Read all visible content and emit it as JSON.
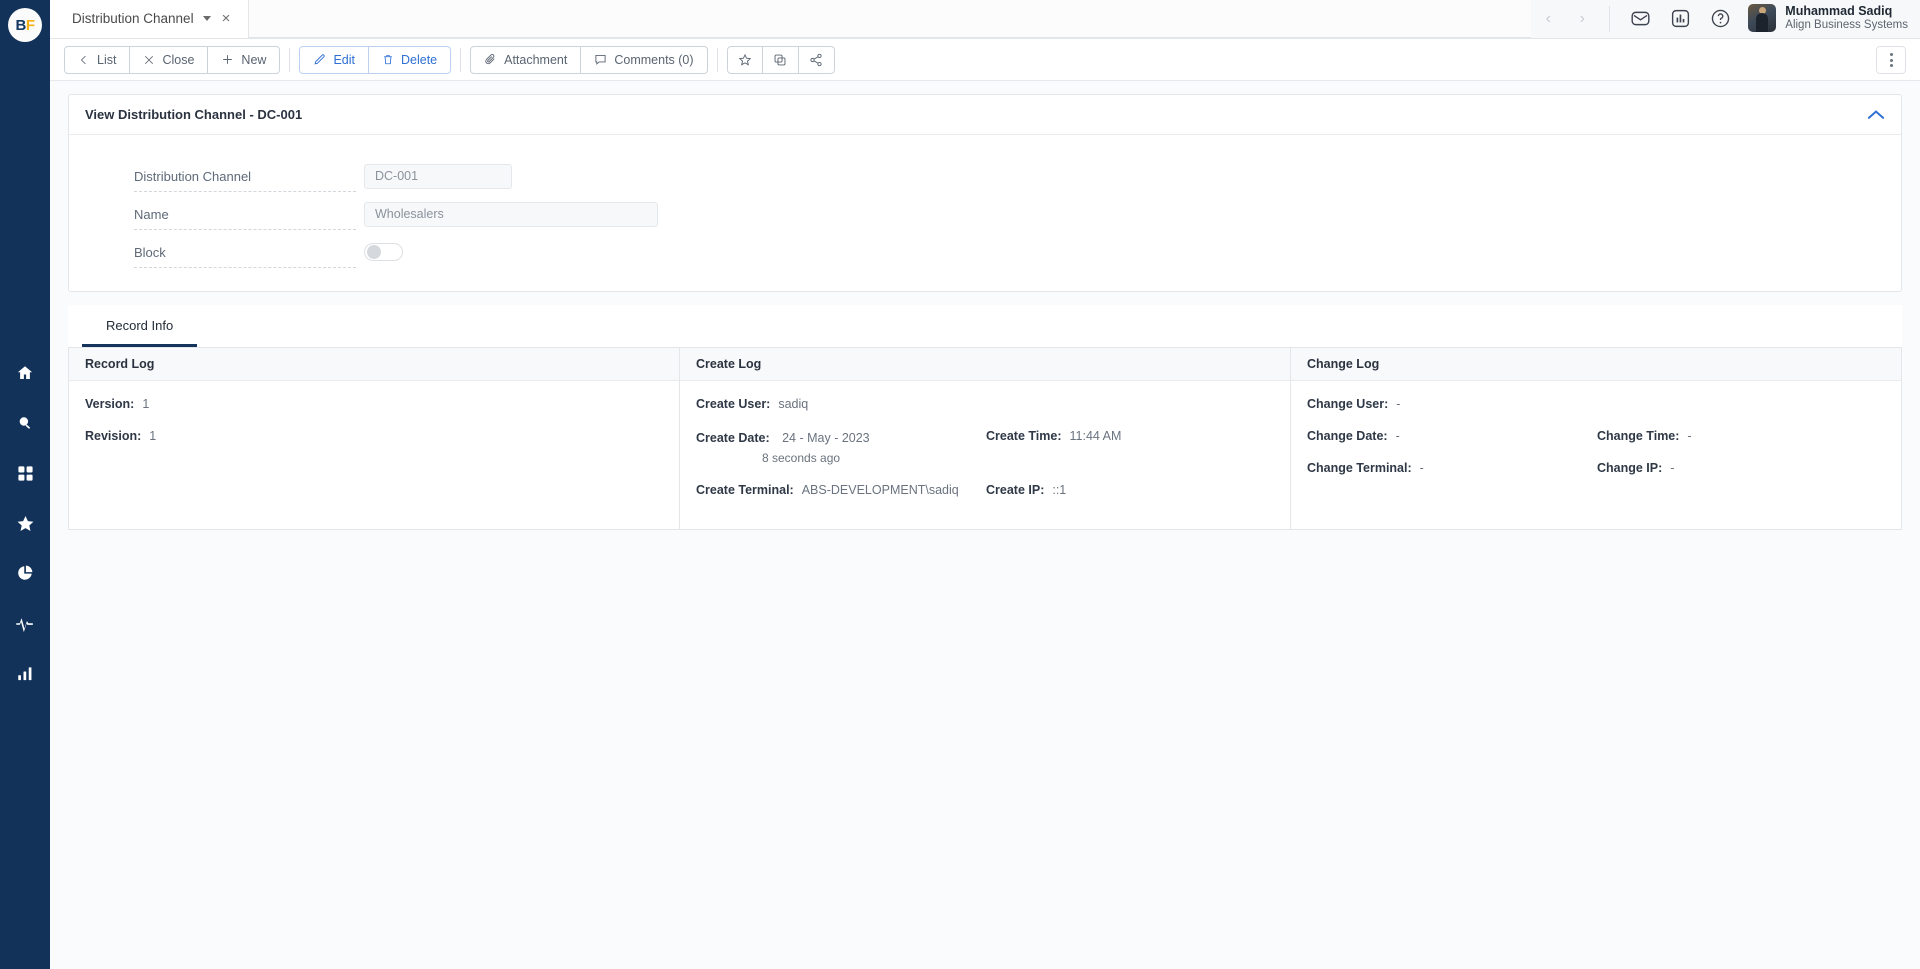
{
  "brand": {
    "logo_b": "B",
    "logo_f": "F",
    "sidebar_color": "#123259",
    "accent_color": "#2e6fd4"
  },
  "sidebar": {
    "items": [
      {
        "icon": "home-icon",
        "label": "Home"
      },
      {
        "icon": "search-icon",
        "label": "Search"
      },
      {
        "icon": "grid-apps-icon",
        "label": "Apps"
      },
      {
        "icon": "star-icon",
        "label": "Favorites"
      },
      {
        "icon": "pie-chart-icon",
        "label": "Reports"
      },
      {
        "icon": "activity-pulse-icon",
        "label": "Activity"
      },
      {
        "icon": "bar-chart-icon",
        "label": "Analytics"
      }
    ]
  },
  "tabbar": {
    "tab_label": "Distribution Channel",
    "close_label": "×",
    "prev_label": "‹",
    "next_label": "›",
    "icons": [
      {
        "name": "mail-icon"
      },
      {
        "name": "chart-report-icon"
      },
      {
        "name": "help-icon"
      }
    ],
    "user": {
      "name": "Muhammad Sadiq",
      "org": "Align Business Systems"
    }
  },
  "toolbar": {
    "list_label": "List",
    "close_label": "Close",
    "new_label": "New",
    "edit_label": "Edit",
    "delete_label": "Delete",
    "attachment_label": "Attachment",
    "comments_label": "Comments (0)",
    "favorite_icon": "star-outline-icon",
    "copy_icon": "copy-icon",
    "share_icon": "share-icon",
    "more_icon": "kebab-menu-icon"
  },
  "form": {
    "title": "View Distribution Channel - DC-001",
    "collapse_icon": "chevron-up-icon",
    "fields": [
      {
        "label": "Distribution Channel",
        "value": "DC-001",
        "type": "text"
      },
      {
        "label": "Name",
        "value": "Wholesalers",
        "type": "text"
      },
      {
        "label": "Block",
        "value": "off",
        "type": "toggle"
      }
    ]
  },
  "record_info": {
    "tabs": [
      {
        "label": "Record Info",
        "active": true
      }
    ],
    "panels": [
      {
        "title": "Record Log",
        "rows": [
          [
            {
              "key": "Version:",
              "value": "1"
            }
          ],
          [
            {
              "key": "Revision:",
              "value": "1"
            }
          ]
        ]
      },
      {
        "title": "Create Log",
        "rows": [
          [
            {
              "key": "Create User:",
              "value": "sadiq"
            }
          ],
          [
            {
              "key": "Create Date:",
              "value": "24 - May - 2023",
              "sub": "8 seconds ago"
            },
            {
              "key": "Create Time:",
              "value": "11:44 AM"
            }
          ],
          [
            {
              "key": "Create Terminal:",
              "value": "ABS-DEVELOPMENT\\sadiq"
            },
            {
              "key": "Create IP:",
              "value": "::1"
            }
          ]
        ]
      },
      {
        "title": "Change Log",
        "rows": [
          [
            {
              "key": "Change User:",
              "value": "-"
            }
          ],
          [
            {
              "key": "Change Date:",
              "value": "-"
            },
            {
              "key": "Change Time:",
              "value": "-"
            }
          ],
          [
            {
              "key": "Change Terminal:",
              "value": "-"
            },
            {
              "key": "Change IP:",
              "value": "-"
            }
          ]
        ]
      }
    ]
  }
}
